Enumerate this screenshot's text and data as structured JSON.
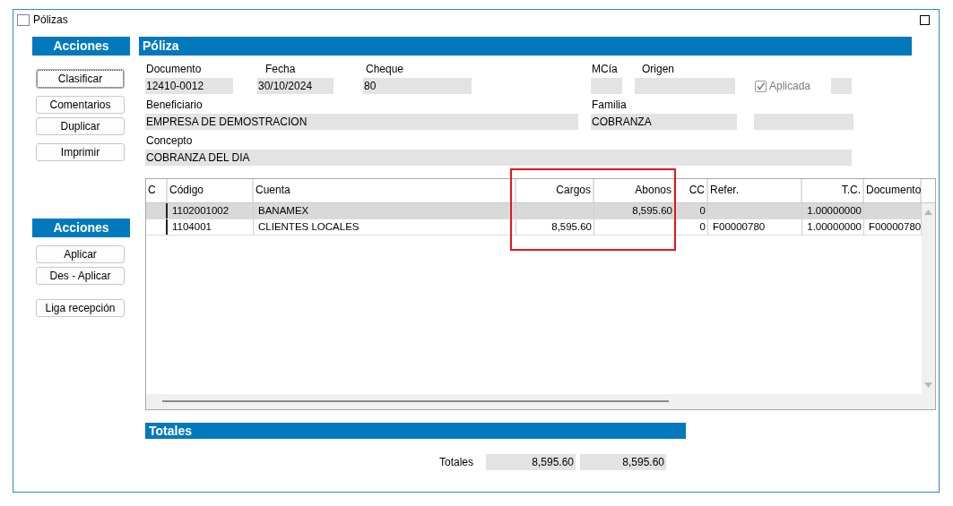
{
  "window": {
    "title": "Pólizas"
  },
  "sidebar": [
    {
      "title": "Acciones",
      "buttons": [
        {
          "label": "Clasificar",
          "focused": true
        },
        {
          "label": "Comentarios",
          "focused": false
        },
        {
          "label": "Duplicar",
          "focused": false
        },
        {
          "label": "Imprimir",
          "focused": false
        }
      ]
    },
    {
      "title": "Acciones",
      "buttons": [
        {
          "label": "Aplicar",
          "focused": false
        },
        {
          "label": "Des - Aplicar",
          "focused": false
        },
        {
          "label": "Liga recepción",
          "focused": false
        }
      ]
    }
  ],
  "poliza": {
    "title": "Póliza",
    "fields": [
      {
        "kind": "field",
        "label": "Documento",
        "value": "12410-0012"
      },
      {
        "kind": "field",
        "label": "Fecha",
        "value": "30/10/2024"
      },
      {
        "kind": "field",
        "label": "Cheque",
        "value": "80"
      },
      {
        "kind": "field",
        "label": "MCía"
      },
      {
        "kind": "field",
        "label": "Origen"
      },
      {
        "kind": "checkbox",
        "label": "Aplicada",
        "checked": true,
        "disabled": true
      },
      {
        "kind": "field"
      },
      {
        "kind": "field",
        "label": "Beneficiario",
        "value": "EMPRESA DE DEMOSTRACION"
      },
      {
        "kind": "field",
        "label": "Familia",
        "value": "COBRANZA"
      },
      {
        "kind": "field"
      },
      {
        "kind": "field",
        "label": "Concepto",
        "value": "COBRANZA DEL DIA"
      }
    ]
  },
  "table": {
    "columns": [
      "C",
      "Código",
      "Cuenta",
      "Cargos",
      "Abonos",
      "CC",
      "Refer.",
      "T.C.",
      "Documento"
    ],
    "rows": [
      {
        "selected": true,
        "cells": [
          "",
          "1102001002",
          "BANAMEX",
          "",
          "8,595.60",
          "0",
          "",
          "1.00000000",
          ""
        ]
      },
      {
        "selected": false,
        "cells": [
          "",
          "1104001",
          "CLIENTES LOCALES",
          "8,595.60",
          "",
          "0",
          "F00000780",
          "1.00000000",
          "F00000780"
        ]
      }
    ]
  },
  "totals": {
    "title": "Totales",
    "label": "Totales",
    "cargos": "8,595.60",
    "abonos": "8,595.60"
  }
}
